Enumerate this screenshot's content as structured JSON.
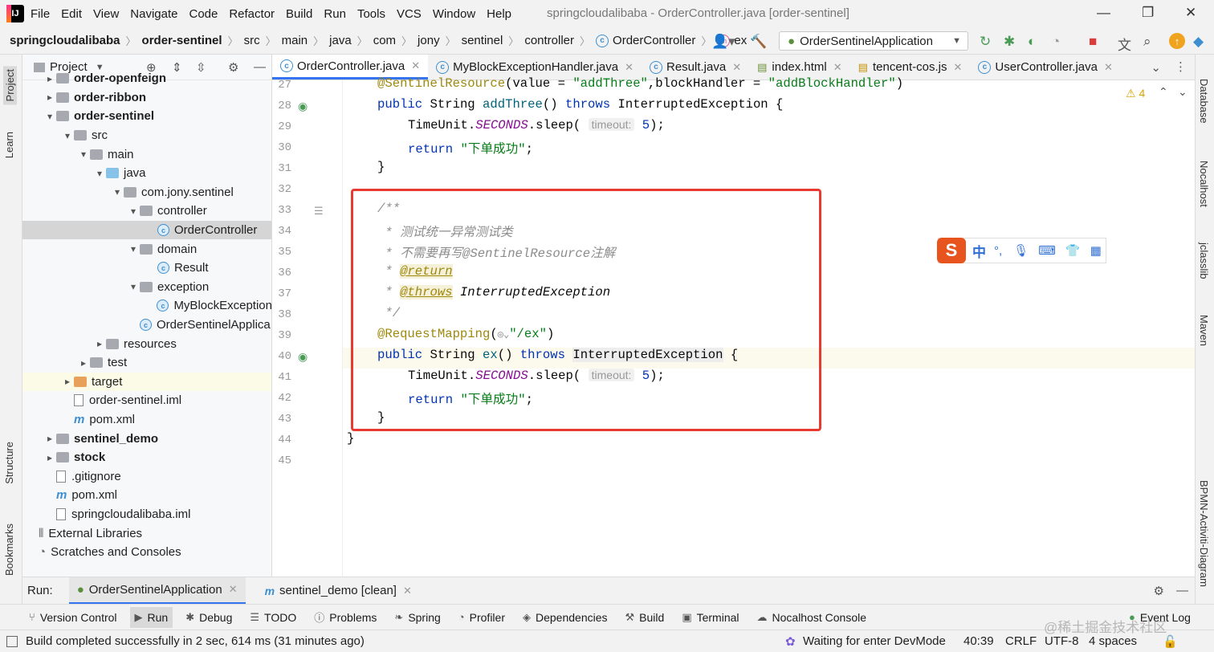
{
  "menubar": {
    "items": [
      "File",
      "Edit",
      "View",
      "Navigate",
      "Code",
      "Refactor",
      "Build",
      "Run",
      "Tools",
      "VCS",
      "Window",
      "Help"
    ],
    "title": "springcloudalibaba - OrderController.java [order-sentinel]"
  },
  "navbar": {
    "crumbs": [
      "springcloudalibaba",
      "order-sentinel",
      "src",
      "main",
      "java",
      "com",
      "jony",
      "sentinel",
      "controller",
      "OrderController",
      "ex"
    ],
    "run_config": "OrderSentinelApplication"
  },
  "leftstrip": {
    "project": "Project",
    "learn": "Learn",
    "structure": "Structure",
    "bookmarks": "Bookmarks"
  },
  "project": {
    "header": "Project",
    "tree": [
      {
        "label": "order-openfeign",
        "bold": true
      },
      {
        "label": "order-ribbon",
        "bold": true
      },
      {
        "label": "order-sentinel",
        "bold": true
      },
      {
        "label": "src"
      },
      {
        "label": "main"
      },
      {
        "label": "java"
      },
      {
        "label": "com.jony.sentinel"
      },
      {
        "label": "controller"
      },
      {
        "label": "OrderController"
      },
      {
        "label": "domain"
      },
      {
        "label": "Result"
      },
      {
        "label": "exception"
      },
      {
        "label": "MyBlockException"
      },
      {
        "label": "OrderSentinelApplica"
      },
      {
        "label": "resources"
      },
      {
        "label": "test"
      },
      {
        "label": "target"
      },
      {
        "label": "order-sentinel.iml"
      },
      {
        "label": "pom.xml"
      },
      {
        "label": "sentinel_demo",
        "bold": true
      },
      {
        "label": "stock",
        "bold": true
      },
      {
        "label": ".gitignore"
      },
      {
        "label": "pom.xml"
      },
      {
        "label": "springcloudalibaba.iml"
      },
      {
        "label": "External Libraries"
      },
      {
        "label": "Scratches and Consoles"
      }
    ]
  },
  "tabs": [
    "OrderController.java",
    "MyBlockExceptionHandler.java",
    "Result.java",
    "index.html",
    "tencent-cos.js",
    "UserController.java"
  ],
  "editor": {
    "lines": [
      "27",
      "28",
      "29",
      "30",
      "31",
      "32",
      "33",
      "34",
      "35",
      "36",
      "37",
      "38",
      "39",
      "40",
      "41",
      "42",
      "43",
      "44",
      "45"
    ],
    "warnings": "4",
    "code": {
      "l27a": "@SentinelResource",
      "l27b": "(value = ",
      "l27c": "\"addThree\"",
      "l27d": ",blockHandler = ",
      "l27e": "\"addBlockHandler\"",
      "l27f": ")",
      "public": "public",
      "string": " String ",
      "addThree": "addThree",
      "parens": "() ",
      "throws": "throws",
      "ie": " InterruptedException {",
      "timeunit": "TimeUnit.",
      "seconds": "SECONDS",
      "sleep": ".sleep( ",
      "timeout": "timeout:",
      "five": " 5",
      "close": ");",
      "return": "return",
      "success": "\"下单成功\"",
      "semi": ";",
      "brace": "}",
      "c1": "/**",
      "c2": " * 测试统一异常测试类",
      "c3": " * 不需要再写@SentinelResource注解",
      "c4a": " * ",
      "c4b": "@return",
      "c5b": "@throws",
      "c5c": " InterruptedException",
      "c6": " */",
      "rm": "@RequestMapping",
      "rm2": "(",
      "ex_path": "\"/ex\"",
      "ex": "ex",
      "ie2": "InterruptedException",
      "ob": " {"
    }
  },
  "ime": {
    "zh": "中"
  },
  "rightstrip": {
    "database": "Database",
    "nocalhost": "Nocalhost",
    "jclasslib": "jclasslib",
    "maven": "Maven",
    "bpmn": "BPMN-Activiti-Diagram"
  },
  "runbar": {
    "label": "Run:",
    "tab1": "OrderSentinelApplication",
    "tab2": "sentinel_demo [clean]"
  },
  "bottom": [
    "Version Control",
    "Run",
    "Debug",
    "TODO",
    "Problems",
    "Spring",
    "Profiler",
    "Dependencies",
    "Build",
    "Terminal",
    "Nocalhost Console"
  ],
  "event_log": "Event Log",
  "status": {
    "message": "Build completed successfully in 2 sec, 614 ms (31 minutes ago)",
    "devmode": "Waiting for enter DevMode",
    "position": "40:39",
    "crlf": "CRLF",
    "encoding": "UTF-8",
    "indent": "4 spaces"
  },
  "watermark": "@稀土掘金技术社区"
}
